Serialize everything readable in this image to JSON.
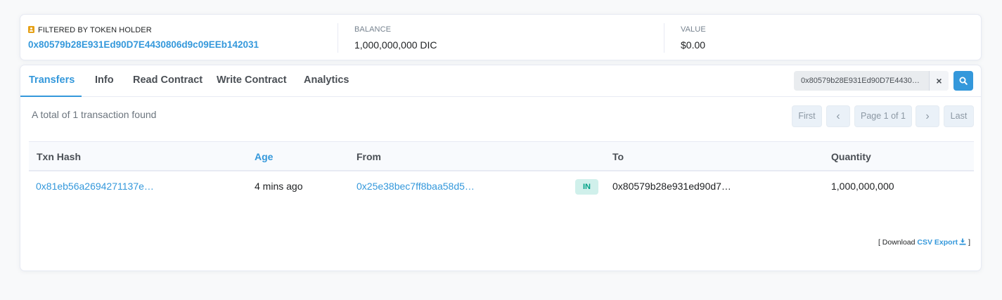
{
  "summary": {
    "holder_label": "FILTERED BY TOKEN HOLDER",
    "holder_address": "0x80579b28E931Ed90D7E4430806d9c09EEb142031",
    "balance_label": "BALANCE",
    "balance_value": "1,000,000,000 DIC",
    "value_label": "VALUE",
    "value_value": "$0.00"
  },
  "tabs": [
    {
      "label": "Transfers",
      "active": true
    },
    {
      "label": "Info"
    },
    {
      "label": "Read Contract"
    },
    {
      "label": "Write Contract"
    },
    {
      "label": "Analytics"
    }
  ],
  "search": {
    "value": "0x80579b28E931Ed90D7E44308…",
    "clear_label": "×"
  },
  "result_summary": "A total of 1 transaction found",
  "pagination": {
    "first": "First",
    "prev": "‹",
    "page": "Page 1 of 1",
    "next": "›",
    "last": "Last"
  },
  "table": {
    "columns": [
      "Txn Hash",
      "Age",
      "From",
      "To",
      "Quantity"
    ],
    "rows": [
      {
        "txn_hash": "0x81eb56a2694271137e…",
        "age": "4 mins ago",
        "from": "0x25e38bec7ff8baa58d5…",
        "direction": "IN",
        "to": "0x80579b28e931ed90d7…",
        "quantity": "1,000,000,000"
      }
    ]
  },
  "download": {
    "prefix": "[ Download",
    "link": "CSV Export",
    "suffix": "]"
  },
  "colors": {
    "accent": "#3498db",
    "in_badge_bg": "#d0f0eb",
    "in_badge_text": "#00a186",
    "holder_icon": "#e6a117"
  },
  "icons": [
    "user-badge-icon",
    "close-icon",
    "search-icon",
    "chevron-left-icon",
    "chevron-right-icon",
    "download-icon"
  ]
}
